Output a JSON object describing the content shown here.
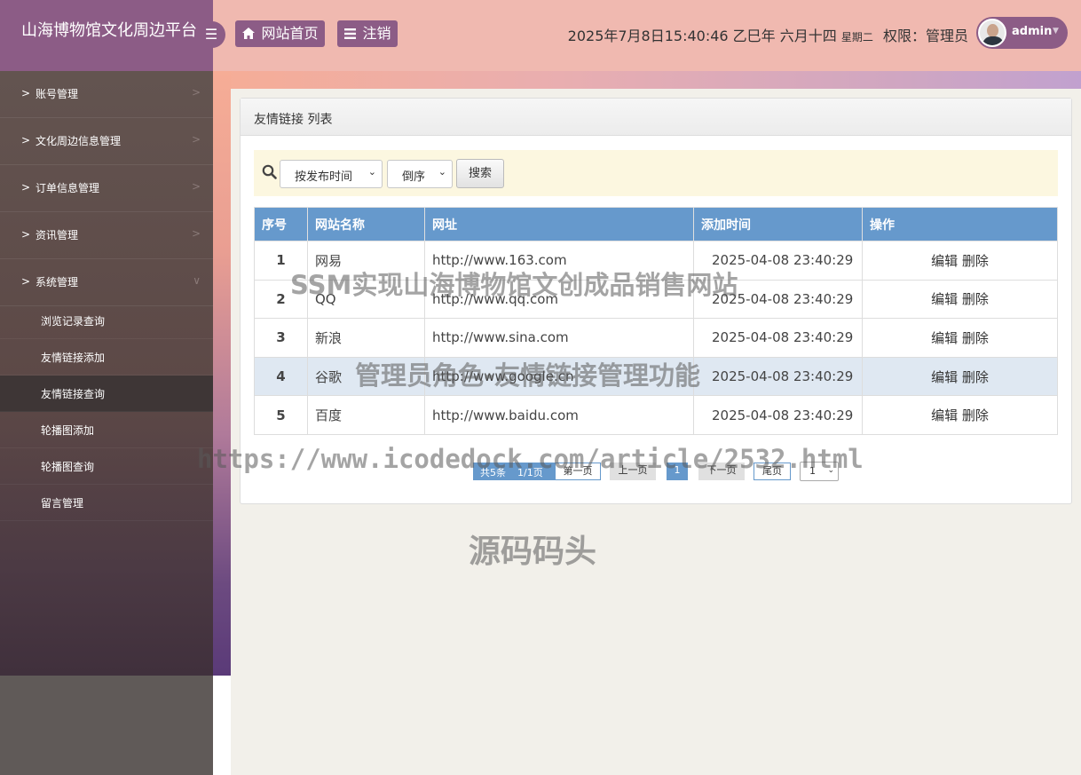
{
  "app": {
    "title": "山海博物馆文化周边平台",
    "toggle_icon": "☰",
    "home_label": "网站首页",
    "logout_label": "注销"
  },
  "header": {
    "datetime": "2025年7月8日15:40:46 乙巳年 六月十四",
    "weekday": "星期二",
    "permission": "权限：管理员",
    "username": "admin"
  },
  "sidebar": {
    "items": [
      {
        "label": "账号管理"
      },
      {
        "label": "文化周边信息管理"
      },
      {
        "label": "订单信息管理"
      },
      {
        "label": "资讯管理"
      },
      {
        "label": "系统管理"
      }
    ],
    "subitems": [
      {
        "label": "浏览记录查询"
      },
      {
        "label": "友情链接添加"
      },
      {
        "label": "友情链接查询"
      },
      {
        "label": "轮播图添加"
      },
      {
        "label": "轮播图查询"
      },
      {
        "label": "留言管理"
      }
    ]
  },
  "panel": {
    "title": "友情链接 列表",
    "sort_field": "按发布时间",
    "sort_order": "倒序",
    "search_label": "搜索"
  },
  "table": {
    "headers": [
      "序号",
      "网站名称",
      "网址",
      "添加时间",
      "操作"
    ],
    "rows": [
      {
        "idx": "1",
        "name": "网易",
        "url": "http://www.163.com",
        "time": "2025-04-08 23:40:29",
        "edit": "编辑",
        "del": "删除"
      },
      {
        "idx": "2",
        "name": "QQ",
        "url": "http://www.qq.com",
        "time": "2025-04-08 23:40:29",
        "edit": "编辑",
        "del": "删除"
      },
      {
        "idx": "3",
        "name": "新浪",
        "url": "http://www.sina.com",
        "time": "2025-04-08 23:40:29",
        "edit": "编辑",
        "del": "删除"
      },
      {
        "idx": "4",
        "name": "谷歌",
        "url": "http://www.google.cn",
        "time": "2025-04-08 23:40:29",
        "edit": "编辑",
        "del": "删除"
      },
      {
        "idx": "5",
        "name": "百度",
        "url": "http://www.baidu.com",
        "time": "2025-04-08 23:40:29",
        "edit": "编辑",
        "del": "删除"
      }
    ]
  },
  "pagination": {
    "total": "共5条",
    "pages": "1/1页",
    "first": "第一页",
    "prev": "上一页",
    "current": "1",
    "next": "下一页",
    "last": "尾页",
    "page_select": "1"
  },
  "watermarks": {
    "line1": "SSM实现山海博物馆文创成品销售网站",
    "line2": "管理员角色-友情链接管理功能",
    "line3": "https://www.icodedock.com/article/2532.html",
    "line4": "源码码头"
  },
  "colors": {
    "header_bg": "#f0b9b0",
    "accent": "#8c5c86",
    "table_header": "#6699cc"
  }
}
